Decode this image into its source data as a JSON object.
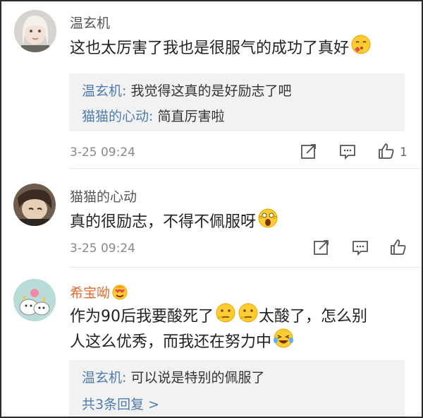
{
  "comments": [
    {
      "username": "温玄机",
      "text": "这也太厉害了我也是很服气的成功了真好",
      "replies": [
        {
          "name": "温玄机",
          "sep": ": ",
          "text": "我觉得这真的是好励志了吧"
        },
        {
          "name": "猫猫的心动",
          "sep": ": ",
          "text": "简直厉害啦"
        }
      ],
      "time": "3-25 09:24",
      "likes": "1"
    },
    {
      "username": "猫猫的心动",
      "text": "真的很励志，不得不佩服呀",
      "time": "3-25 09:24"
    },
    {
      "username": "希宝呦",
      "text_line1": "作为90后我要酸死了",
      "text_line1_tail": "太酸了，怎么别",
      "text_line2": "人这么优秀，而我还在努力中",
      "replies": [
        {
          "name": "温玄机",
          "sep": ": ",
          "text": "可以说是特别的佩服了"
        }
      ],
      "more_replies": "共3条回复 >"
    }
  ],
  "icons": {
    "forward": "share-edit-icon",
    "reply": "comment-icon",
    "like": "thumbs-up-icon"
  },
  "colors": {
    "name_gray": "#555555",
    "name_orange": "#e36a2e",
    "reply_name_blue": "#4f7cae",
    "reply_bg": "#f2f2f2"
  }
}
